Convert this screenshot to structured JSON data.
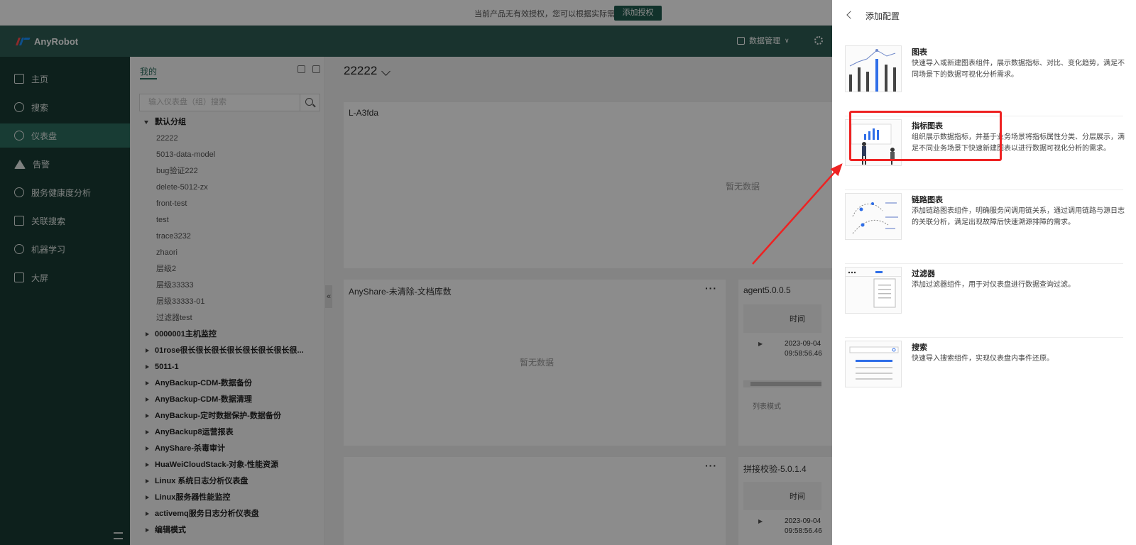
{
  "banner": {
    "notice": "当前产品无有效授权，您可以根据实际需求",
    "button": "添加授权"
  },
  "header": {
    "app_name": "AnyRobot",
    "data_menu": "数据管理",
    "brand_colors": [
      "#ff4d4f",
      "#1890ff"
    ]
  },
  "sidebar": {
    "items": [
      {
        "label": "主页",
        "icon": "grid-icon"
      },
      {
        "label": "搜索",
        "icon": "search-icon"
      },
      {
        "label": "仪表盘",
        "icon": "dashboard-icon",
        "active": true
      },
      {
        "label": "告警",
        "icon": "warning-icon"
      },
      {
        "label": "服务健康度分析",
        "icon": "health-icon"
      },
      {
        "label": "关联搜索",
        "icon": "link-search-icon"
      },
      {
        "label": "机器学习",
        "icon": "ml-icon"
      },
      {
        "label": "大屏",
        "icon": "bigscreen-icon"
      }
    ]
  },
  "tree": {
    "tab": "我的",
    "search_placeholder": "输入仪表盘（组）搜索",
    "default_group": "默认分组",
    "leaves": [
      "22222",
      "5013-data-model",
      "bug验证222",
      "delete-5012-zx",
      "front-test",
      "test",
      "trace3232",
      "zhaori",
      "层级2",
      "层级33333",
      "层级33333-01",
      "过滤器test"
    ],
    "groups": [
      "0000001主机监控",
      "01rose很长很长很长很长很长很长很长很...",
      "5011-1",
      "AnyBackup-CDM-数据备份",
      "AnyBackup-CDM-数据清理",
      "AnyBackup-定时数据保护-数据备份",
      "AnyBackup8运营报表",
      "AnyShare-杀毒审计",
      "HuaWeiCloudStack-对象-性能资源",
      "Linux 系统日志分析仪表盘",
      "Linux服务器性能监控",
      "activemq服务日志分析仪表盘",
      "编辑模式"
    ]
  },
  "dashboard": {
    "title": "22222",
    "collapse": "«",
    "cards": {
      "card1": {
        "title": "L-A3fda",
        "empty": "暂无数据"
      },
      "card2": {
        "title": "AnyShare-未清除-文档库数",
        "empty": "暂无数据",
        "more": "···"
      },
      "card3": {
        "title": "agent5.0.0.5",
        "col": "时间",
        "ts1": "2023-09-04",
        "ts2": "09:58:56.46",
        "mode": "列表模式"
      },
      "card4": {
        "more": "···"
      },
      "card5": {
        "title": "拼接校验-5.0.1.4",
        "col": "时间",
        "ts1": "2023-09-04",
        "ts2": "09:58:56.46"
      }
    }
  },
  "drawer": {
    "title": "添加配置",
    "options": [
      {
        "name": "图表",
        "desc": "快速导入或新建图表组件，展示数据指标、对比、变化趋势，满足不同场景下的数据可视化分析需求。"
      },
      {
        "name": "指标图表",
        "desc": "组织展示数据指标，并基于业务场景将指标属性分类、分层展示，满足不同业务场景下快速新建图表以进行数据可视化分析的需求。"
      },
      {
        "name": "链路图表",
        "desc": "添加链路图表组件，明确服务间调用链关系，通过调用链路与源日志的关联分析，满足出现故障后快速溯源排障的需求。"
      },
      {
        "name": "过滤器",
        "desc": "添加过滤器组件，用于对仪表盘进行数据查询过滤。"
      },
      {
        "name": "搜索",
        "desc": "快速导入搜索组件，实现仪表盘内事件还原。"
      }
    ]
  },
  "annotation": {
    "color": "#ee2222"
  }
}
